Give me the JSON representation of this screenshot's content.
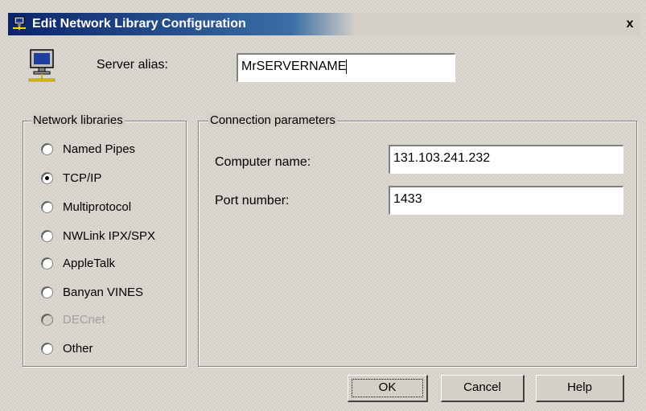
{
  "window": {
    "title": "Edit Network Library Configuration",
    "close_glyph": "x",
    "title_icon": "network-config-icon"
  },
  "server_alias": {
    "label": "Server alias:",
    "value": "MrSERVERNAME",
    "icon": "computer-network-icon"
  },
  "network_libraries": {
    "title": "Network libraries",
    "items": [
      {
        "label": "Named Pipes",
        "selected": false,
        "enabled": true
      },
      {
        "label": "TCP/IP",
        "selected": true,
        "enabled": true
      },
      {
        "label": "Multiprotocol",
        "selected": false,
        "enabled": true
      },
      {
        "label": "NWLink IPX/SPX",
        "selected": false,
        "enabled": true
      },
      {
        "label": "AppleTalk",
        "selected": false,
        "enabled": true
      },
      {
        "label": "Banyan VINES",
        "selected": false,
        "enabled": true
      },
      {
        "label": "DECnet",
        "selected": false,
        "enabled": false
      },
      {
        "label": "Other",
        "selected": false,
        "enabled": true
      }
    ]
  },
  "connection_parameters": {
    "title": "Connection parameters",
    "computer_name_label": "Computer name:",
    "computer_name_value": "131.103.241.232",
    "port_number_label": "Port number:",
    "port_number_value": "1433"
  },
  "buttons": {
    "ok": "OK",
    "cancel": "Cancel",
    "help": "Help"
  },
  "colors": {
    "title_bar": "#0a246a",
    "face": "#d4d0c8"
  }
}
